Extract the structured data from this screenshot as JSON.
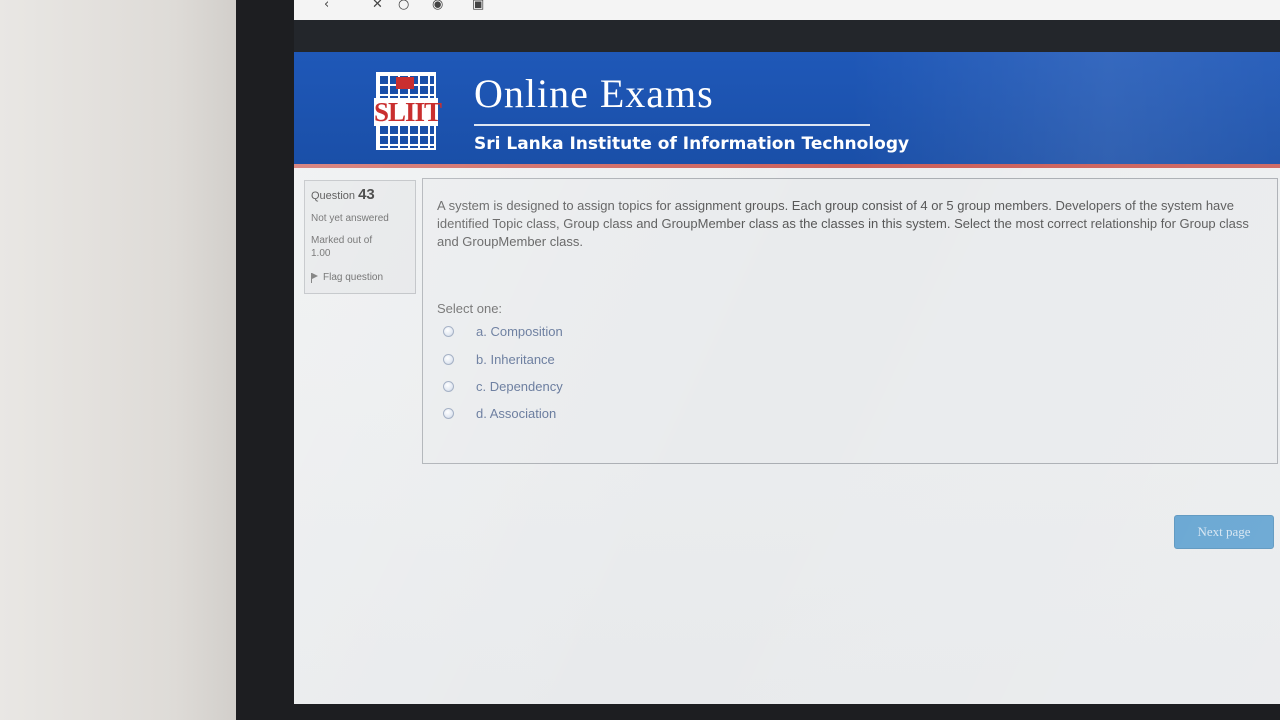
{
  "header": {
    "logo_text": "SLIIT",
    "title": "Online Exams",
    "subtitle": "Sri Lanka Institute of Information Technology"
  },
  "question_info": {
    "label": "Question",
    "number": "43",
    "state": "Not yet answered",
    "mark_label": "Marked out of",
    "mark_value": "1.00",
    "flag_label": "Flag question"
  },
  "question": {
    "text": "A system is designed to assign topics for assignment groups. Each group consist of 4 or 5 group members. Developers of the system have identified Topic class, Group class and GroupMember class as the classes in this system. Select the most correct relationship for Group class and GroupMember class.",
    "prompt": "Select one:",
    "options": [
      {
        "label": "a. Composition",
        "selected": false
      },
      {
        "label": "b. Inheritance",
        "selected": false
      },
      {
        "label": "c. Dependency",
        "selected": false
      },
      {
        "label": "d. Association",
        "selected": false
      }
    ]
  },
  "navigation": {
    "next_label": "Next page"
  },
  "colors": {
    "header_blue": "#1f58b8",
    "accent_red": "#c7473f",
    "button_blue": "#3d8fc9"
  },
  "icons": [
    "flag-icon",
    "radio-icon"
  ]
}
